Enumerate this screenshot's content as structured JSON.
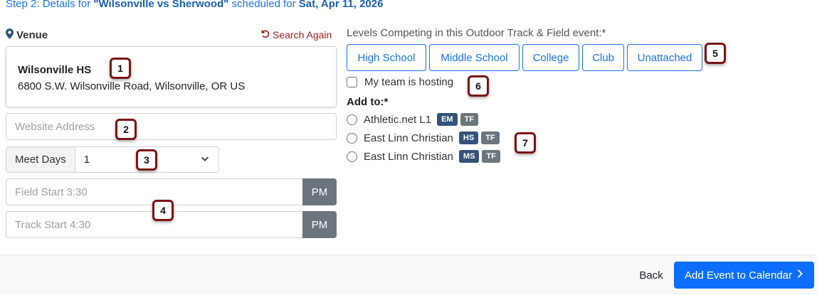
{
  "header": {
    "prefix": "Step 2: Details for ",
    "event_name": "\"Wilsonville vs Sherwood\"",
    "middle": " scheduled for ",
    "date": "Sat, Apr 11, 2026"
  },
  "venue": {
    "label": "Venue",
    "search_again": "Search Again",
    "name": "Wilsonville HS",
    "address": "6800 S.W. Wilsonville Road, Wilsonville, OR  US"
  },
  "website": {
    "placeholder": "Website Address"
  },
  "meet_days": {
    "label": "Meet Days",
    "value": "1"
  },
  "field_start": {
    "placeholder": "Field Start 3:30",
    "ampm": "PM"
  },
  "track_start": {
    "placeholder": "Track Start 4:30",
    "ampm": "PM"
  },
  "levels": {
    "label": "Levels Competing in this Outdoor Track & Field event:*",
    "options": [
      "High School",
      "Middle School",
      "College",
      "Club",
      "Unattached"
    ]
  },
  "hosting": {
    "label": "My team is hosting",
    "checked": false
  },
  "add_to": {
    "label": "Add to:*",
    "options": [
      {
        "name": "Athletic.net L1",
        "badges": [
          "EM",
          "TF"
        ]
      },
      {
        "name": "East Linn Christian",
        "badges": [
          "HS",
          "TF"
        ]
      },
      {
        "name": "East Linn Christian",
        "badges": [
          "MS",
          "TF"
        ]
      }
    ]
  },
  "markers": [
    "1",
    "2",
    "3",
    "4",
    "5",
    "6",
    "7"
  ],
  "footer": {
    "back": "Back",
    "submit": "Add Event to Calendar"
  },
  "colors": {
    "primary": "#0d6efd",
    "link": "#1a73e8",
    "marker_border": "#7a1414",
    "badge_dark": "#34527a",
    "badge_gray": "#6c757d"
  }
}
